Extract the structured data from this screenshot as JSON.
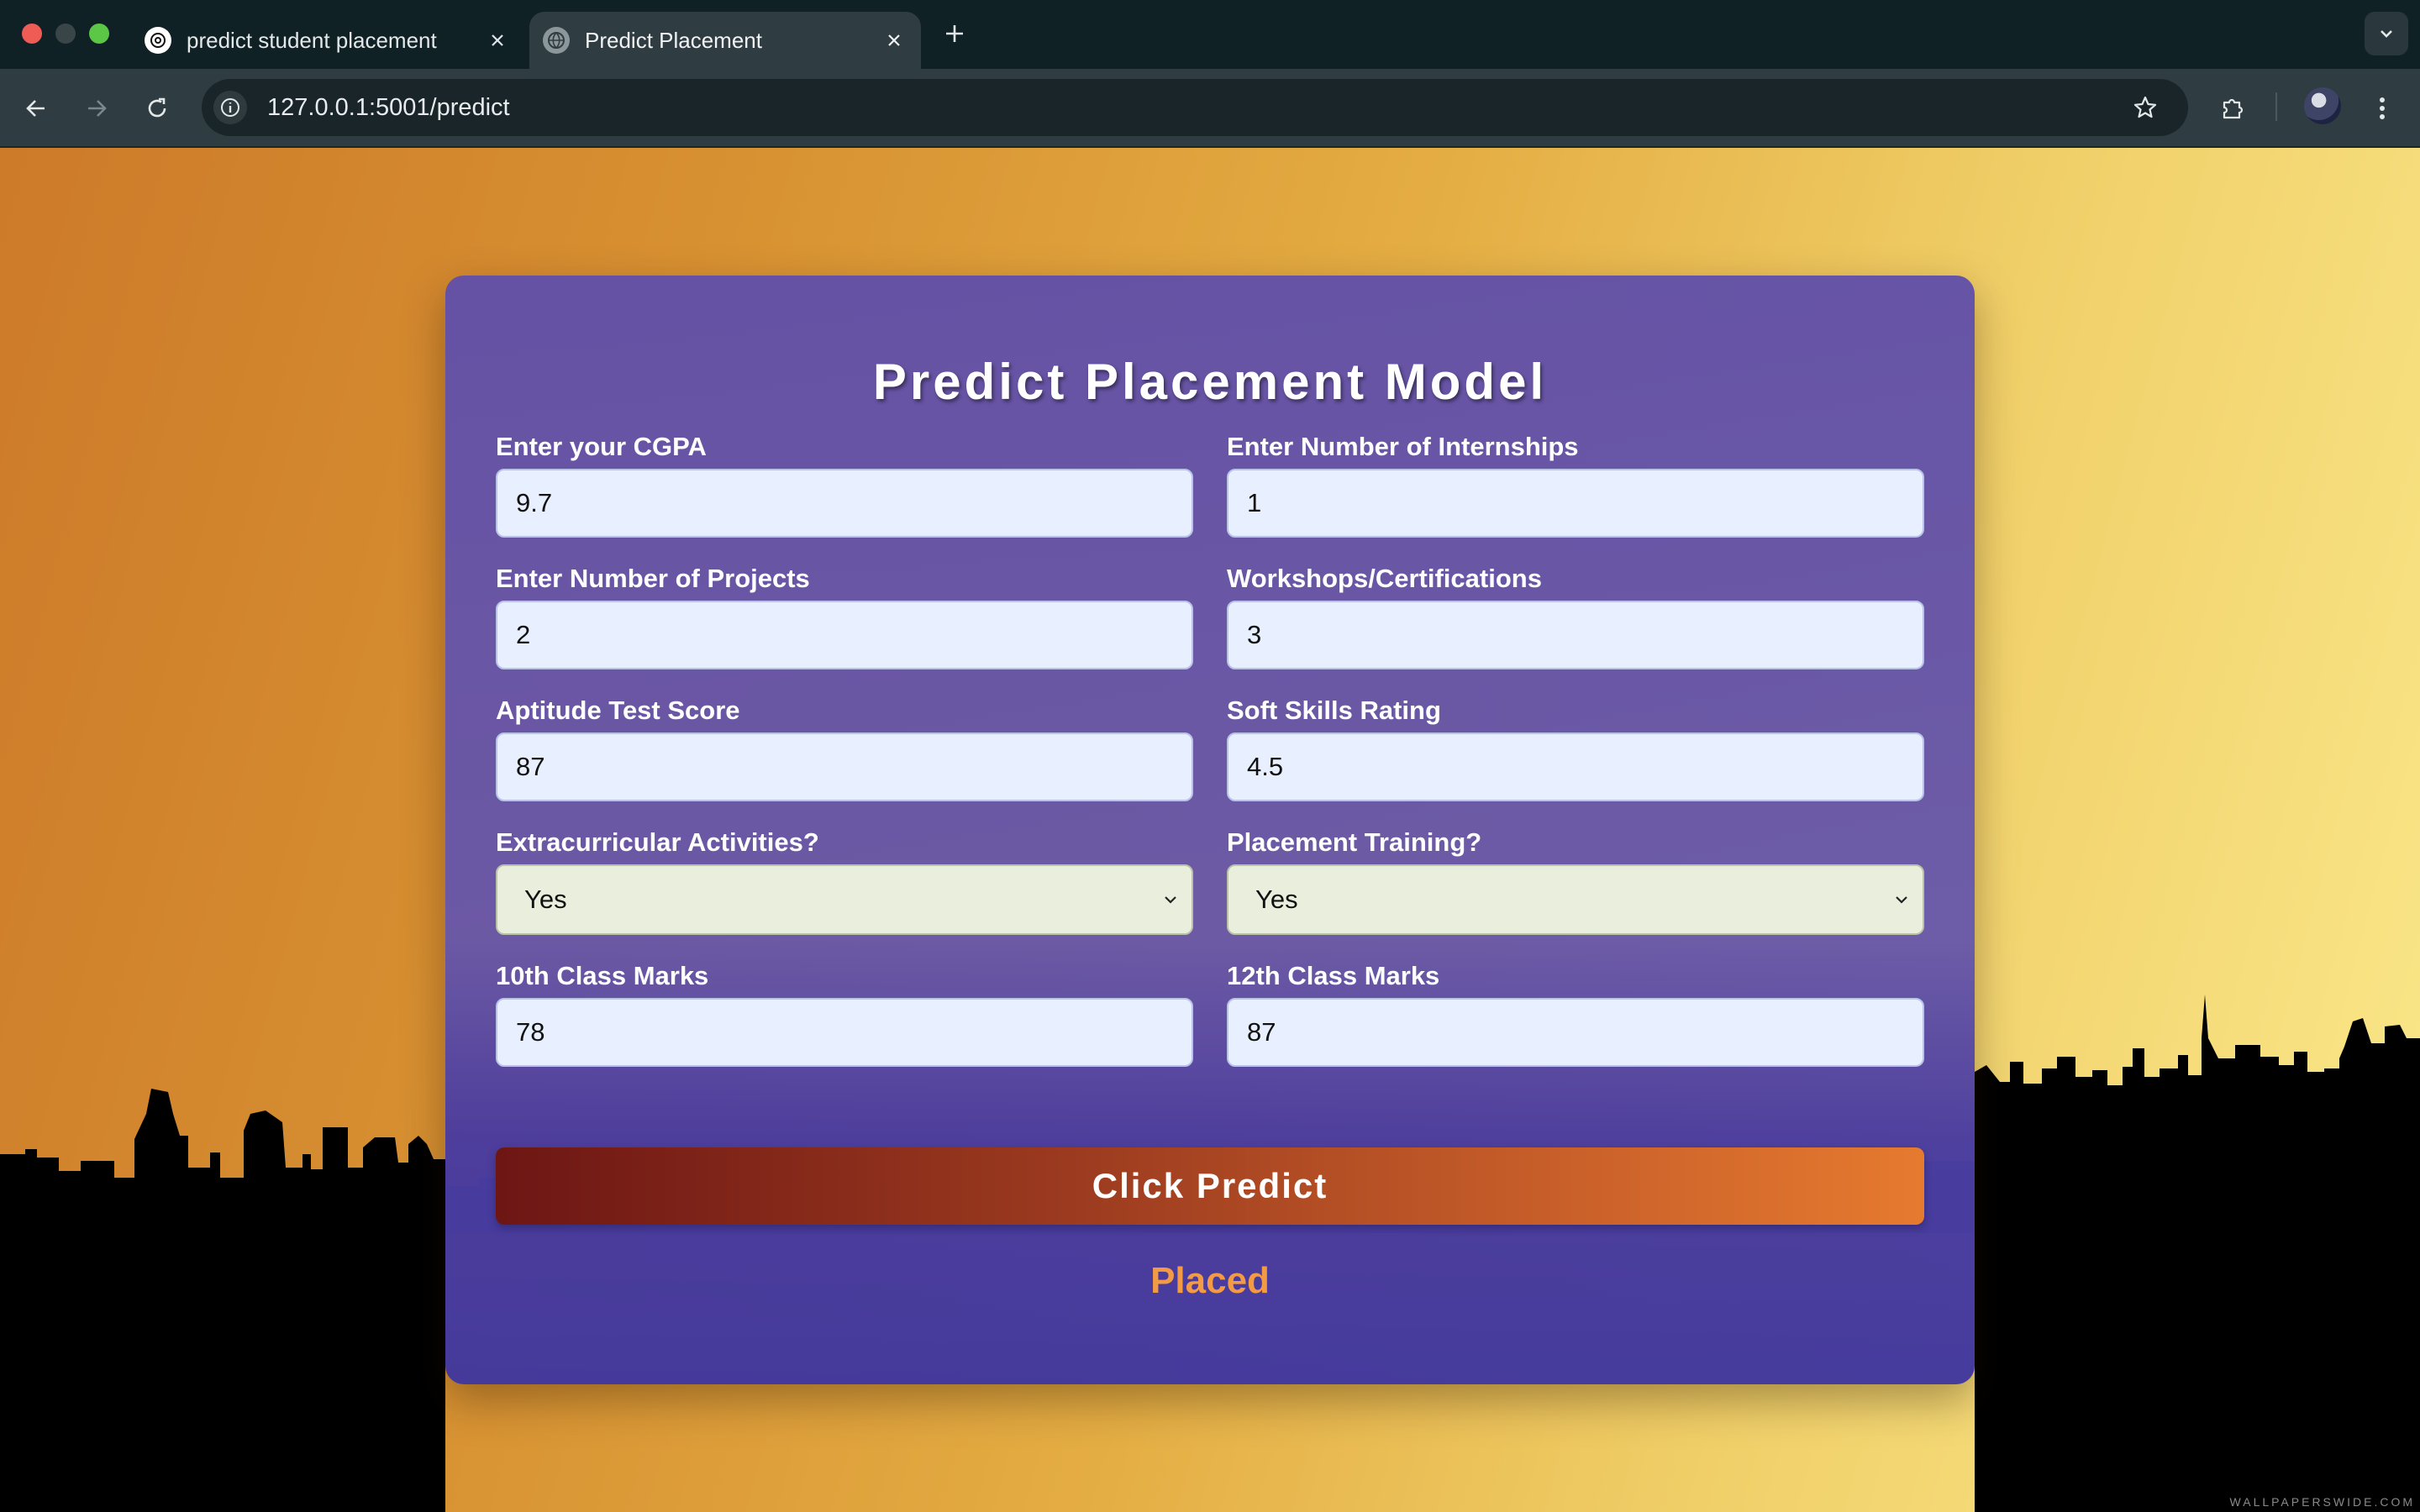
{
  "browser": {
    "tabs": [
      {
        "title": "predict student placement",
        "active": false,
        "favicon": "openai-icon"
      },
      {
        "title": "Predict Placement",
        "active": true,
        "favicon": "globe-icon"
      }
    ],
    "url": "127.0.0.1:5001/predict"
  },
  "form": {
    "title": "Predict Placement Model",
    "fields": [
      {
        "label": "Enter your CGPA",
        "value": "9.7"
      },
      {
        "label": "Enter Number of Internships",
        "value": "1"
      },
      {
        "label": "Enter Number of Projects",
        "value": "2"
      },
      {
        "label": "Workshops/Certifications",
        "value": "3"
      },
      {
        "label": "Aptitude Test Score",
        "value": "87"
      },
      {
        "label": "Soft Skills Rating",
        "value": "4.5"
      },
      {
        "label": "Extracurricular Activities?",
        "value": "Yes"
      },
      {
        "label": "Placement Training?",
        "value": "Yes"
      },
      {
        "label": "10th Class Marks",
        "value": "78"
      },
      {
        "label": "12th Class Marks",
        "value": "87"
      }
    ],
    "button_label": "Click Predict",
    "result": "Placed"
  },
  "wallpaper": {
    "watermark": "WALLPAPERSWIDE.COM"
  },
  "colors": {
    "card": "#6250a8",
    "button_start": "#6d1614",
    "button_end": "#e67a2f",
    "result": "#f39a45",
    "input_bg": "#e8efff",
    "select_bg": "#e9efdc"
  }
}
